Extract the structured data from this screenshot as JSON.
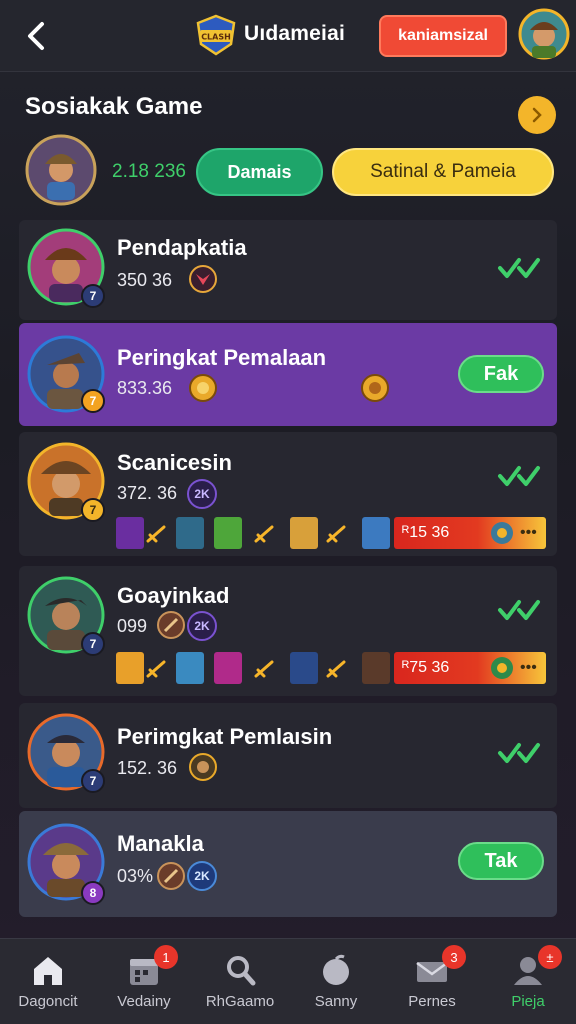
{
  "header": {
    "title": "Uıdameiai",
    "cta_label": "kaniamsizal",
    "logo_text": "CLASH"
  },
  "section": {
    "title": "Sosiakak Game",
    "my_score": "2.18 236",
    "btn_primary": "Damais",
    "btn_secondary": "Satinal & Pameia"
  },
  "rows": [
    {
      "name": "Pendapkatia",
      "score": "350 36",
      "badge": "7",
      "action": "check"
    },
    {
      "name": "Peringkat Pemalaan",
      "score": "833.36",
      "badge": "7",
      "action": "Fak"
    },
    {
      "name": "Scanicesin",
      "score": "372. 36",
      "badge": "7",
      "tag": "2K",
      "rank": "ᴿ15 36",
      "action": "check"
    },
    {
      "name": "Goayinkad",
      "score": "099",
      "badge": "7",
      "tag": "2K",
      "rank": "ᴿ75 36",
      "action": "check"
    },
    {
      "name": "Perimgkat Pemlaısin",
      "score": "152. 36",
      "badge": "7",
      "action": "check"
    },
    {
      "name": "Manakla",
      "score": "03%",
      "badge": "8",
      "tag": "2K",
      "action": "Tak"
    }
  ],
  "nav": [
    {
      "label": "Dagoncit",
      "icon": "home-icon",
      "badge": null,
      "active": false
    },
    {
      "label": "Vedainy",
      "icon": "calendar-icon",
      "badge": "1",
      "active": false
    },
    {
      "label": "RhGaamo",
      "icon": "search-icon",
      "badge": null,
      "active": false
    },
    {
      "label": "Sanny",
      "icon": "apple-icon",
      "badge": null,
      "active": false
    },
    {
      "label": "Pernes",
      "icon": "mail-icon",
      "badge": "3",
      "active": false
    },
    {
      "label": "Pieja",
      "icon": "person-icon",
      "badge": "±",
      "active": true
    }
  ],
  "colors": {
    "accent_green": "#3fcf6a",
    "cta_red": "#f04a35",
    "highlight_purple": "#6b3aa4",
    "button_yellow": "#f7d23b"
  }
}
